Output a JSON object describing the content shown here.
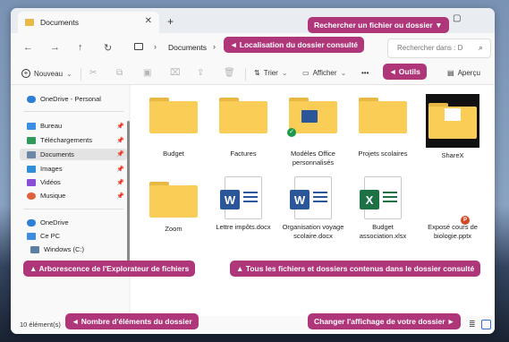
{
  "window": {
    "tab_title": "Documents",
    "tab_close": "✕",
    "new_tab": "+"
  },
  "nav": {
    "back": "←",
    "forward": "→",
    "up": "↑",
    "refresh": "↻",
    "breadcrumb": "Documents",
    "search_placeholder": "Rechercher dans : D",
    "search_icon": "⌕"
  },
  "toolbar": {
    "new_label": "Nouveau",
    "sort_label": "Trier",
    "view_label": "Afficher",
    "more_label": "•••",
    "preview_label": "Aperçu"
  },
  "sidebar": {
    "onedrive_personal": "OneDrive - Personal",
    "quick_access": [
      {
        "label": "Bureau",
        "color": "#3a8ee6"
      },
      {
        "label": "Téléchargements",
        "color": "#2f9a5a"
      },
      {
        "label": "Documents",
        "color": "#6d87a8"
      },
      {
        "label": "Images",
        "color": "#2f8fd9"
      },
      {
        "label": "Vidéos",
        "color": "#8b4fd6"
      },
      {
        "label": "Musique",
        "color": "#e0613a"
      }
    ],
    "onedrive": "OneDrive",
    "this_pc": "Ce PC",
    "windows_drive": "Windows (C:)"
  },
  "files": [
    {
      "name": "Budget",
      "kind": "folder"
    },
    {
      "name": "Factures",
      "kind": "folder"
    },
    {
      "name": "Modèles Office personnalisés",
      "kind": "folder"
    },
    {
      "name": "Projets scolaires",
      "kind": "folder"
    },
    {
      "name": "ShareX",
      "kind": "folder"
    },
    {
      "name": "Zoom",
      "kind": "folder"
    },
    {
      "name": "Lettre impôts.docx",
      "kind": "word"
    },
    {
      "name": "Organisation voyage scolaire.docx",
      "kind": "word"
    },
    {
      "name": "Budget association.xlsx",
      "kind": "excel"
    },
    {
      "name": "Exposé cours de biologie.pptx",
      "kind": "powerpoint"
    }
  ],
  "status": {
    "count": "10 élément(s)"
  },
  "callouts": {
    "search": "Rechercher un fichier ou dossier ▼",
    "location": "◄ Localisation du dossier consulté",
    "tools": "◄ Outils",
    "tree": "▲ Arborescence de l'Explorateur de fichiers",
    "contents": "▲ Tous les fichiers et dossiers contenus dans le dossier consulté",
    "count": "◄ Nombre d'éléments du dossier",
    "view": "Changer l'affichage de votre dossier ►"
  },
  "colors": {
    "accent": "#b0367a",
    "folder": "#f9cd56",
    "word": "#2b579a",
    "excel": "#1e7145",
    "powerpoint": "#d24726"
  }
}
